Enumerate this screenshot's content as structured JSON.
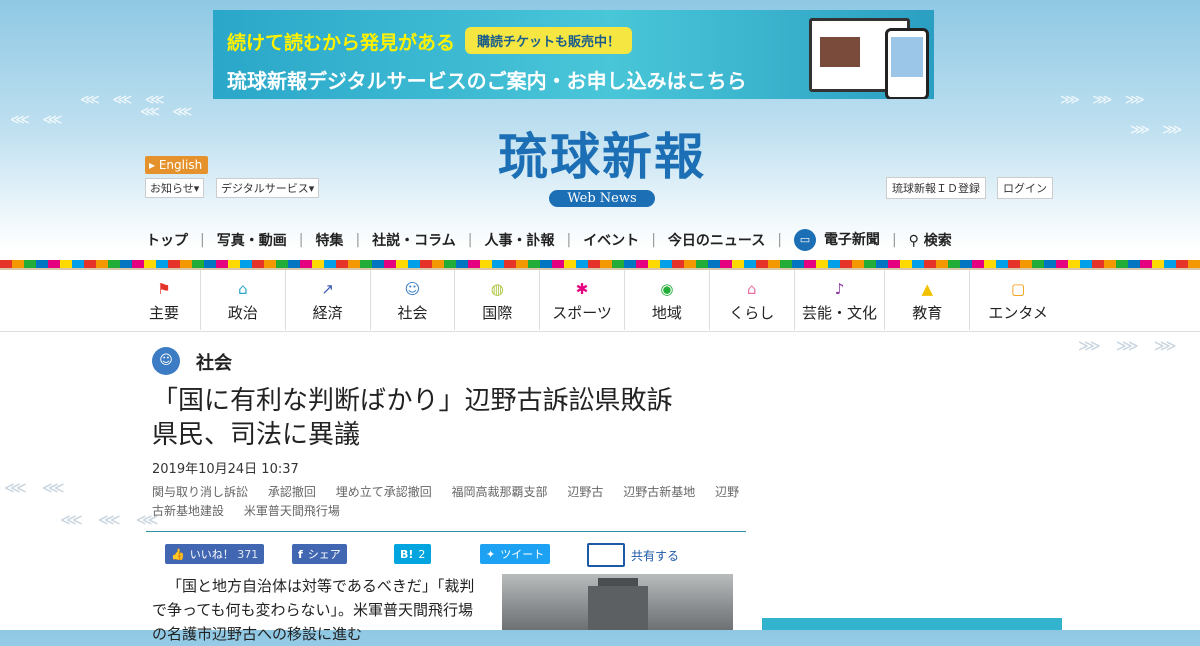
{
  "banner": {
    "line1": "続けて読むから発見がある",
    "pill": "購読チケットも販売中！",
    "line2": "琉球新報デジタルサービスのご案内・お申し込みはこちら"
  },
  "header": {
    "english": "English",
    "menu_news": "お知らせ▾",
    "menu_digital": "デジタルサービス▾",
    "logo": "琉球新報",
    "logo_sub": "Web News",
    "register": "琉球新報ＩＤ登録",
    "login": "ログイン"
  },
  "main_nav": [
    "トップ",
    "写真・動画",
    "特集",
    "社説・コラム",
    "人事・訃報",
    "イベント",
    "今日のニュース",
    "電子新聞",
    "検索"
  ],
  "categories": [
    {
      "label": "主要",
      "icon": "flag-icon",
      "glyph": "⚑",
      "color": "#e6332a"
    },
    {
      "label": "政治",
      "icon": "parliament-icon",
      "glyph": "⌂",
      "color": "#2ea7c9"
    },
    {
      "label": "経済",
      "icon": "chart-icon",
      "glyph": "↗",
      "color": "#3b5bb0"
    },
    {
      "label": "社会",
      "icon": "people-icon",
      "glyph": "☺",
      "color": "#3b7cc4"
    },
    {
      "label": "国際",
      "icon": "globe-icon",
      "glyph": "◍",
      "color": "#a8c23a"
    },
    {
      "label": "スポーツ",
      "icon": "runner-icon",
      "glyph": "✱",
      "color": "#e4007f"
    },
    {
      "label": "地域",
      "icon": "map-pin-icon",
      "glyph": "◉",
      "color": "#22ac38"
    },
    {
      "label": "くらし",
      "icon": "house-icon",
      "glyph": "⌂",
      "color": "#e86fa0"
    },
    {
      "label": "芸能・文化",
      "icon": "sanshin-icon",
      "glyph": "♪",
      "color": "#8c3aa0"
    },
    {
      "label": "教育",
      "icon": "graduation-cap-icon",
      "glyph": "▲",
      "color": "#f2c200"
    },
    {
      "label": "エンタメ",
      "icon": "tv-icon",
      "glyph": "▢",
      "color": "#f39800"
    }
  ],
  "article": {
    "section": "社会",
    "headline": "「国に有利な判断ばかり」辺野古訴訟県敗訴　県民、司法に異議",
    "date": "2019年10月24日 10:37",
    "tags": [
      "関与取り消し訴訟",
      "承認撤回",
      "埋め立て承認撤回",
      "福岡高裁那覇支部",
      "辺野古",
      "辺野古新基地",
      "辺野古新基地建設",
      "米軍普天間飛行場"
    ],
    "body": "「国と地方自治体は対等であるべきだ」「裁判で争っても何も変わらない」。米軍普天間飛行場の名護市辺野古への移設に進む"
  },
  "social": {
    "like": "いいね！",
    "like_count": "371",
    "fb_share": "シェア",
    "hatena": "B!",
    "hatena_count": "2",
    "tweet": "ツイート",
    "share": "共有する"
  },
  "colors": {
    "brand": "#1c6fb4",
    "facebook": "#4267b2",
    "twitter": "#1da1f2",
    "hatena": "#00a4de",
    "english": "#e5922c"
  }
}
